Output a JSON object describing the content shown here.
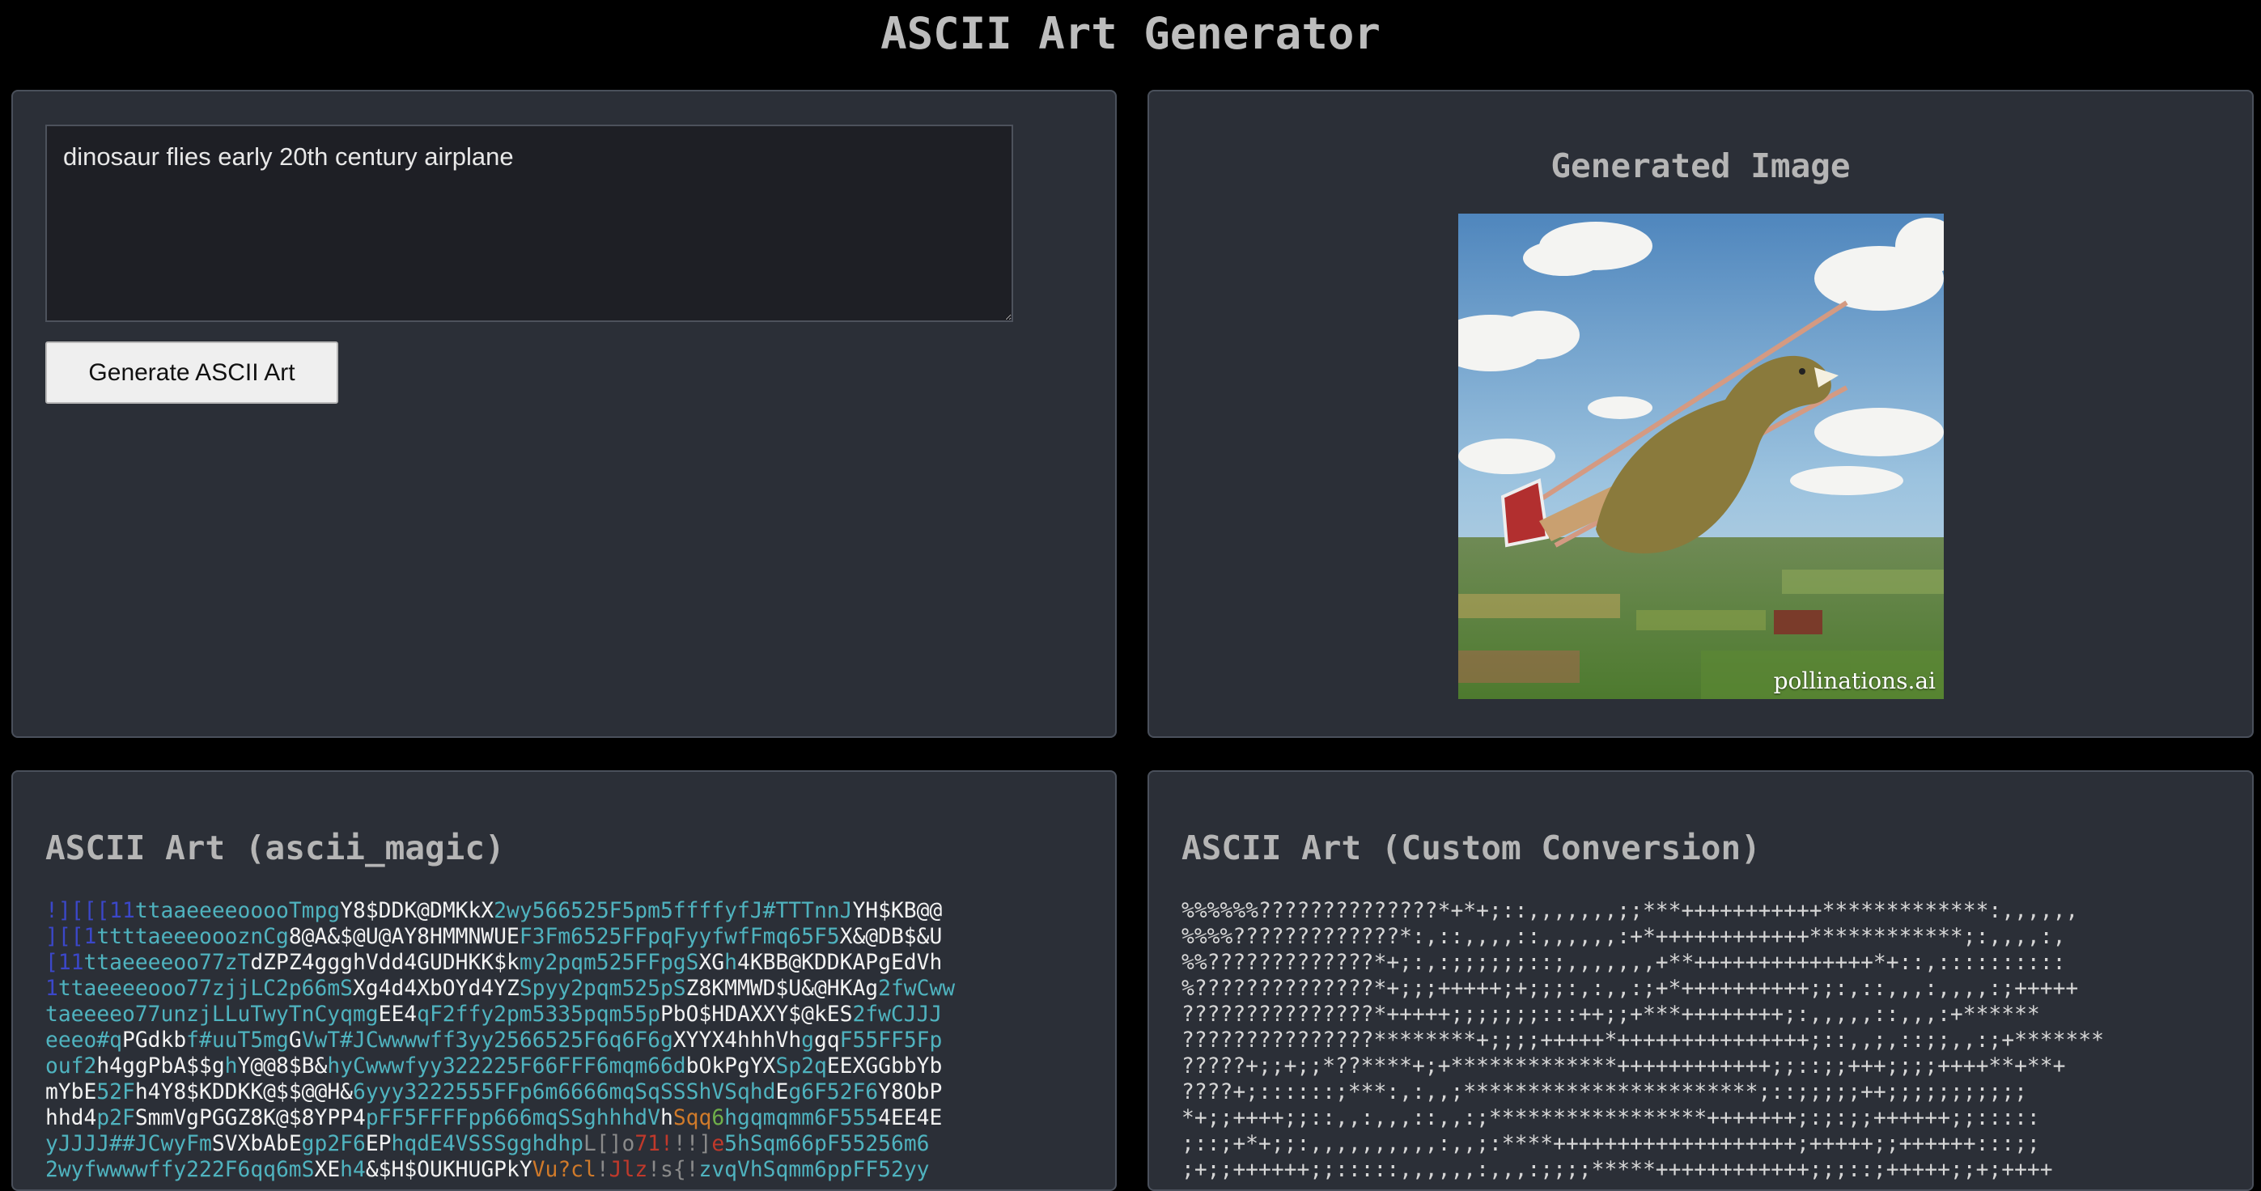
{
  "app": {
    "title": "ASCII Art Generator"
  },
  "input_panel": {
    "prompt_value": "dinosaur flies early 20th century airplane",
    "generate_label": "Generate ASCII Art"
  },
  "image_panel": {
    "title": "Generated Image",
    "image_description": "photo",
    "watermark": "pollinations.ai"
  },
  "magic_panel": {
    "title": "ASCII Art (ascii_magic)",
    "palette": {
      "navy": "#3b47c9",
      "teal": "#4fb3bf",
      "white": "#f2f2f2",
      "grey": "#8a8a8a",
      "orange": "#d07a2a",
      "green": "#6fb04a",
      "red": "#c0392b"
    },
    "lines": [
      [
        [
          "!][[[11",
          "navy"
        ],
        [
          "ttaaeeeeooooTmpg",
          "teal"
        ],
        [
          "Y8$DDK@DMKkX",
          "white"
        ],
        [
          "2wy566525F5pm5ffffyfJ#TTTnnJ",
          "teal"
        ],
        [
          "YH$KB@@",
          "white"
        ]
      ],
      [
        [
          "][[1",
          "navy"
        ],
        [
          "ttttaeeeoooznCg",
          "teal"
        ],
        [
          "8@A&$@U@AY8HMMNWUE",
          "white"
        ],
        [
          "F3Fm6525FFpqFyyfwfFmq65F5",
          "teal"
        ],
        [
          "X&@DB$&U",
          "white"
        ]
      ],
      [
        [
          "[11",
          "navy"
        ],
        [
          "ttaeeeeoo77zT",
          "teal"
        ],
        [
          "dZPZ4ggghVdd4GUDHKK$k",
          "white"
        ],
        [
          "my2pqm525FFpgS",
          "teal"
        ],
        [
          "XG",
          "white"
        ],
        [
          "h",
          "teal"
        ],
        [
          "4KBB@KDDKAPgEdVh",
          "white"
        ]
      ],
      [
        [
          "1",
          "navy"
        ],
        [
          "ttaeeeeooo77zjjLC2p66mS",
          "teal"
        ],
        [
          "Xg4d4XbOYd4YZ",
          "white"
        ],
        [
          "Spyy2pqm525pS",
          "teal"
        ],
        [
          "Z8KMMWD$U&@HKAg",
          "white"
        ],
        [
          "2fwCww",
          "teal"
        ]
      ],
      [
        [
          "taeeeeo77unzjLLuTwyTnCyqmg",
          "teal"
        ],
        [
          "EE4",
          "white"
        ],
        [
          "qF2ffy2pm5335pqm55p",
          "teal"
        ],
        [
          "PbO$HDAXXY$@kES",
          "white"
        ],
        [
          "2fwCJJJ",
          "teal"
        ]
      ],
      [
        [
          "eeeo#q",
          "teal"
        ],
        [
          "PGdkb",
          "white"
        ],
        [
          "f#uuT5mg",
          "teal"
        ],
        [
          "G",
          "white"
        ],
        [
          "VwT#JCwwwwff3yy2566525F6q6F6g",
          "teal"
        ],
        [
          "XYYX4hhhVh",
          "white"
        ],
        [
          "g",
          "teal"
        ],
        [
          "gq",
          "white"
        ],
        [
          "F55FF5Fp",
          "teal"
        ]
      ],
      [
        [
          "ouf2",
          "teal"
        ],
        [
          "h4ggPbA$$g",
          "white"
        ],
        [
          "h",
          "teal"
        ],
        [
          "Y@@8$B&",
          "white"
        ],
        [
          "hyCwwwfyy322225F66FFF6mqm66d",
          "teal"
        ],
        [
          "bOkPgYX",
          "white"
        ],
        [
          "Sp2q",
          "teal"
        ],
        [
          "EEXGGbbYb",
          "white"
        ]
      ],
      [
        [
          "mYbE",
          "white"
        ],
        [
          "52F",
          "teal"
        ],
        [
          "h4Y8$KDDKK@$$@@H&",
          "white"
        ],
        [
          "6yyy3222555FFp6m6666mqSqSSShVSqhd",
          "teal"
        ],
        [
          "E",
          "white"
        ],
        [
          "g6F52F6",
          "teal"
        ],
        [
          "Y8ObP",
          "white"
        ]
      ],
      [
        [
          "hhd4",
          "white"
        ],
        [
          "p2F",
          "teal"
        ],
        [
          "SmmVgPGGZ8K@$8YPP4",
          "white"
        ],
        [
          "pFF5FFFFpp666mqSSghhhdV",
          "teal"
        ],
        [
          "h",
          "white"
        ],
        [
          "Sqq",
          "orange"
        ],
        [
          "6",
          "green"
        ],
        [
          "hgqmqmm6F555",
          "teal"
        ],
        [
          "4EE4E",
          "white"
        ]
      ],
      [
        [
          "yJJJJ##JCwyFm",
          "teal"
        ],
        [
          "SVXbAbE",
          "white"
        ],
        [
          "gp2F6",
          "teal"
        ],
        [
          "EP",
          "white"
        ],
        [
          "hqdE4VSSSgghdhp",
          "teal"
        ],
        [
          "L[]o",
          "grey"
        ],
        [
          "71!",
          "red"
        ],
        [
          "!!]",
          "grey"
        ],
        [
          "e",
          "red"
        ],
        [
          "5hSqm66pF55256m6",
          "teal"
        ]
      ],
      [
        [
          "2wyfwwwwffy222F6qq6mS",
          "teal"
        ],
        [
          "XE",
          "white"
        ],
        [
          "h4",
          "teal"
        ],
        [
          "&$H$OUKHUGPkY",
          "white"
        ],
        [
          "Vu?cl",
          "orange"
        ],
        [
          "!",
          "grey"
        ],
        [
          "Jlz",
          "red"
        ],
        [
          "!s{!",
          "grey"
        ],
        [
          "zvqVhSqmm6ppFF52yy",
          "teal"
        ]
      ]
    ]
  },
  "custom_panel": {
    "title": "ASCII Art (Custom Conversion)",
    "lines": [
      "%%%%%%??????????????*+*+;::,,,,,,,;;***+++++++++++*************:,,,,,,",
      "%%%%?????????????*:,::,,,,::,,,,,,:+*++++++++++++************;:,,,,:,",
      "%%?????????????*+;:,:;;;;;;::;,,,,,,,+**++++++++++++++*+::,::::::::::",
      "%??????????????*+;;;+++++;+;;;:,:,,:;+*++++++++++;;:,::,,,:,,,,:;+++++",
      "???????????????*+++++;;;;;;;:::++;;+***++++++++;:,,,,,::,,,:+******",
      "???????????????********+;;;;+++++*+++++++++++++++;::,,;,::;;,,:;+*******",
      "?????+;;+;;*??****+;+*************++++++++++++;;::;;+++;;;;++++**+**+",
      "????+;::::::;***:,:,,;***********************;::;;;;;++;;;;;;;;;;;",
      "*+;;++++;;::,,:,,,::,,:;*****************+++++++;:;:;;++++++;;:::::",
      ";::;+*+;;:,,,,,,,,,,:,,;:****+++++++++++++++++++;+++++;;++++++:::;;",
      ";+;;++++++;;:::::,,,,,,:,,,:;;;;*****++++++++++++;;;::;+++++;;+;++++"
    ]
  }
}
